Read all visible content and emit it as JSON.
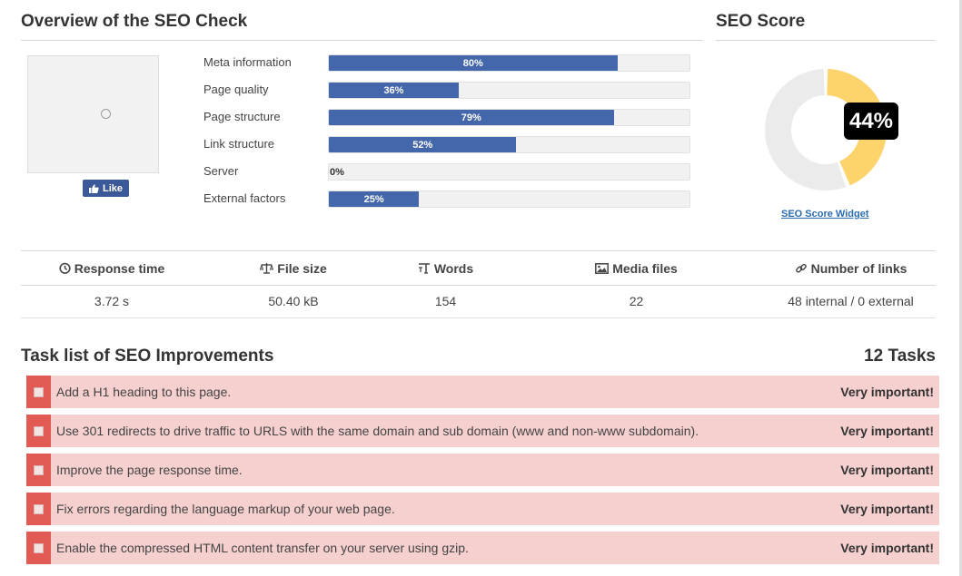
{
  "overview": {
    "title": "Overview of the SEO Check"
  },
  "score_section": {
    "title": "SEO Score",
    "score_label": "44%",
    "score_value": 44,
    "widget_link": "SEO Score Widget",
    "colors": {
      "score": "#fdd36b",
      "rest": "#ebebeb"
    }
  },
  "like_button": {
    "label": "Like"
  },
  "metrics": [
    {
      "label": "Meta information",
      "value": 80,
      "text": "80%"
    },
    {
      "label": "Page quality",
      "value": 36,
      "text": "36%"
    },
    {
      "label": "Page structure",
      "value": 79,
      "text": "79%"
    },
    {
      "label": "Link structure",
      "value": 52,
      "text": "52%"
    },
    {
      "label": "Server",
      "value": 0,
      "text": "0%"
    },
    {
      "label": "External factors",
      "value": 25,
      "text": "25%"
    }
  ],
  "stats": {
    "headers": [
      {
        "icon": "stopwatch-icon",
        "label": "Response time"
      },
      {
        "icon": "scale-icon",
        "label": "File size"
      },
      {
        "icon": "text-icon",
        "label": "Words"
      },
      {
        "icon": "image-icon",
        "label": "Media files"
      },
      {
        "icon": "link-icon",
        "label": "Number of links"
      }
    ],
    "values": [
      "3.72 s",
      "50.40 kB",
      "154",
      "22",
      "48 internal / 0 external"
    ]
  },
  "tasks": {
    "title": "Task list of SEO Improvements",
    "count": "12 Tasks",
    "items": [
      {
        "text": "Add a H1 heading to this page.",
        "priority": "Very important!"
      },
      {
        "text": "Use 301 redirects to drive traffic to URLS with the same domain and sub domain (www and non-www subdomain).",
        "priority": "Very important!"
      },
      {
        "text": "Improve the page response time.",
        "priority": "Very important!"
      },
      {
        "text": "Fix errors regarding the language markup of your web page.",
        "priority": "Very important!"
      },
      {
        "text": "Enable the compressed HTML content transfer on your server using gzip.",
        "priority": "Very important!"
      }
    ]
  }
}
